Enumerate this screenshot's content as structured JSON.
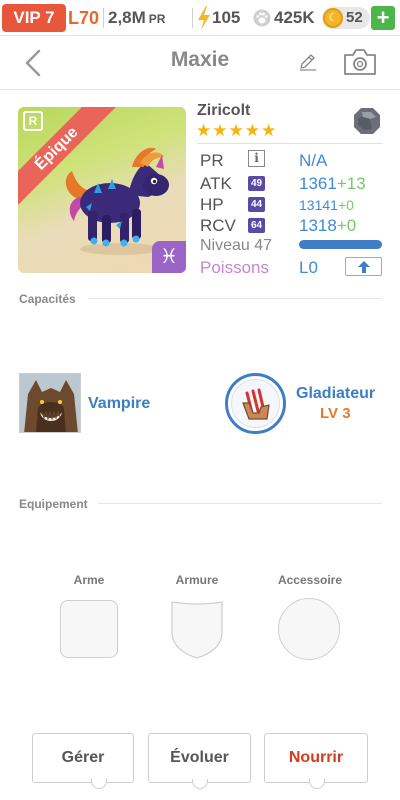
{
  "status": {
    "vip": "VIP 7",
    "level": "L70",
    "pr_value": "2,8M",
    "pr_unit": "PR",
    "energy": "105",
    "food": "425K",
    "gems": "52",
    "add": "+"
  },
  "header": {
    "title": "Maxie"
  },
  "monster": {
    "rarity_badge": "R",
    "rarity": "Épique",
    "zodiac": "♓",
    "name": "Ziricolt",
    "stars": "★★★★★",
    "stats": {
      "pr_label": "PR",
      "pr_info": "i",
      "pr_value": "N/A",
      "atk_label": "ATK",
      "atk_level": "49",
      "atk_value": "1361",
      "atk_bonus": "+13",
      "hp_label": "HP",
      "hp_level": "44",
      "hp_value": "13141",
      "hp_bonus": "+0",
      "rcv_label": "RCV",
      "rcv_level": "64",
      "rcv_value": "1318",
      "rcv_bonus": "+0"
    },
    "level_label": "Niveau 47",
    "xp_fraction": 1.0,
    "food_label": "Poissons",
    "food_level": "L0"
  },
  "capacites": {
    "label": "Capacités",
    "ability1": "Vampire",
    "ability2": "Gladiateur",
    "ability2_level": "LV 3"
  },
  "equipement": {
    "label": "Equipement",
    "slots": [
      "Arme",
      "Armure",
      "Accessoire"
    ]
  },
  "actions": {
    "manage": "Gérer",
    "evolve": "Évoluer",
    "feed": "Nourrir"
  },
  "colors": {
    "accent": "#3f8bd6",
    "vip": "#e8563c",
    "feed": "#d83a1e",
    "epic": "#e9655a"
  }
}
